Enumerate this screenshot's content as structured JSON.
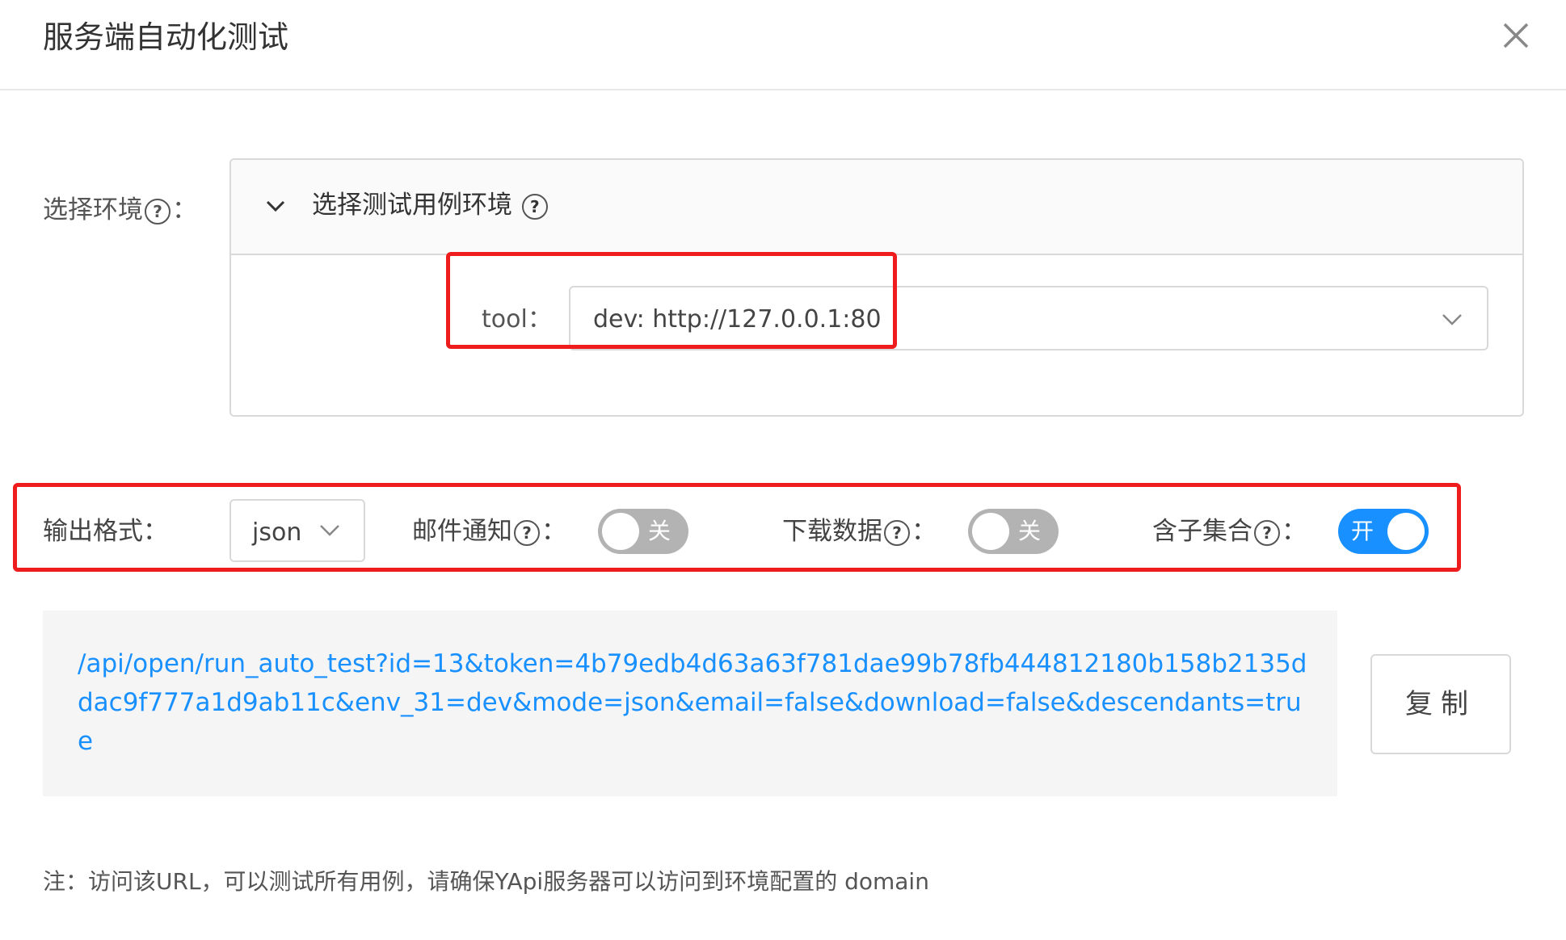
{
  "modal": {
    "title": "服务端自动化测试",
    "close_icon": "close-icon"
  },
  "env": {
    "label": "选择环境",
    "label_colon": "：",
    "help_icon": "question-circle-icon",
    "panel_title": "选择测试用例环境",
    "panel_chevron_icon": "chevron-down-icon",
    "tool_label": "tool",
    "tool_colon": "：",
    "tool_value": "dev: http://127.0.0.1:80",
    "tool_chevron_icon": "chevron-down-icon"
  },
  "options": {
    "format_label": "输出格式",
    "format_colon": "：",
    "format_value": "json",
    "email_label": "邮件通知",
    "email_state": "关",
    "email_on": false,
    "download_label": "下载数据",
    "download_state": "关",
    "download_on": false,
    "descendants_label": "含子集合",
    "descendants_state": "开",
    "descendants_on": true,
    "colon": "："
  },
  "url": {
    "text": "/api/open/run_auto_test?id=13&token=4b79edb4d63a63f781dae99b78fb444812180b158b2135ddac9f777a1d9ab11c&env_31=dev&mode=json&email=false&download=false&descendants=true",
    "copy_label": "复制"
  },
  "note": "注：访问该URL，可以测试所有用例，请确保YApi服务器可以访问到环境配置的 domain",
  "colors": {
    "accent": "#1890ff",
    "highlight": "#ee1c1c",
    "switch_off": "#b3b3b3"
  }
}
